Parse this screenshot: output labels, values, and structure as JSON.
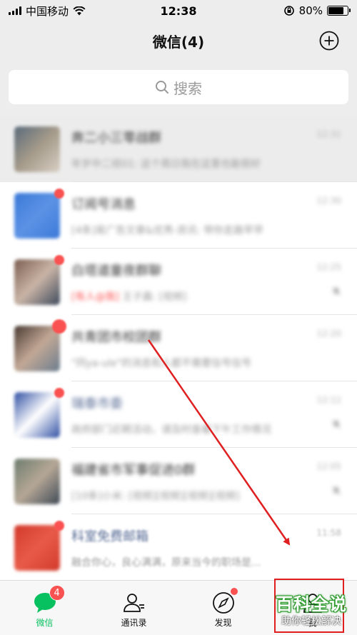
{
  "status_bar": {
    "carrier": "中国移动",
    "time": "12:38",
    "battery_percent": "80%",
    "battery_level": 0.8
  },
  "nav": {
    "title": "微信(4)",
    "add_icon": "plus-circle-icon"
  },
  "search": {
    "placeholder": "搜索",
    "icon": "search-icon"
  },
  "chats": [
    {
      "name": "奔二小三零战群",
      "preview": "年岁中二班01: 这个周日我在这里也能很好",
      "time": "12:31",
      "pinned": true,
      "badge": false,
      "avatar_colors": [
        "#5a6a7a",
        "#a59b8a",
        "#d9cfc4"
      ]
    },
    {
      "name": "订阅号消息",
      "preview": "[4条]易广告文章&优秀-资讯: 带你走路早早",
      "time": "12:30",
      "badge": true,
      "avatar_colors": [
        "#3c7ad8",
        "#5b92e5",
        "#3c7ad8"
      ]
    },
    {
      "name": "白塔道童夜群聊",
      "preview_tag": "[有人@我]",
      "preview": "王子晨: [视频]",
      "time": "12:25",
      "badge": true,
      "muted": true,
      "avatar_colors": [
        "#7b5e50",
        "#c9b4a6",
        "#3e4a5c"
      ]
    },
    {
      "name": "共青团市校团群",
      "preview": "\"同ya-ule\"的消息和人都不需要信号信号",
      "time": "12:20",
      "badge": true,
      "badge_big": true,
      "avatar_colors": [
        "#4a3b33",
        "#c2a896",
        "#6b7d8e"
      ]
    },
    {
      "name": "瑞泰市委",
      "preview": "政府部门近期活动，请及时查看下午工作情况",
      "time": "12:12",
      "badge": true,
      "blue_name": true,
      "muted": true,
      "avatar_colors": [
        "#2f4fa3",
        "#ffffff",
        "#2f4fa3"
      ]
    },
    {
      "name": "福建省市军事促进0群",
      "preview": "[10条]小米: [视频][视频][视频][视频]",
      "time": "12:05",
      "badge": false,
      "muted": true,
      "avatar_colors": [
        "#6d7c6e",
        "#b5a796",
        "#3f4a55"
      ]
    },
    {
      "name": "科室免费邮箱",
      "preview": "融合你心，良心满满，原来当今的职场是...",
      "time": "11:58",
      "badge": true,
      "blue_name": true,
      "avatar_colors": [
        "#d23a2c",
        "#e85a48",
        "#d23a2c"
      ]
    }
  ],
  "tabs": [
    {
      "key": "chats",
      "label": "微信",
      "icon": "chat-bubble-icon",
      "badge": "4",
      "active": true
    },
    {
      "key": "contacts",
      "label": "通讯录",
      "icon": "contacts-icon",
      "active": false
    },
    {
      "key": "discover",
      "label": "发现",
      "icon": "compass-icon",
      "dot": true,
      "active": false
    },
    {
      "key": "me",
      "label": "我",
      "icon": "person-icon",
      "active": false
    }
  ],
  "watermark": {
    "title": "百科全说",
    "subtitle": "助你轻松解决"
  },
  "colors": {
    "wechat_green": "#07c160",
    "badge_red": "#fa5151",
    "annotation_red": "#e02020"
  }
}
